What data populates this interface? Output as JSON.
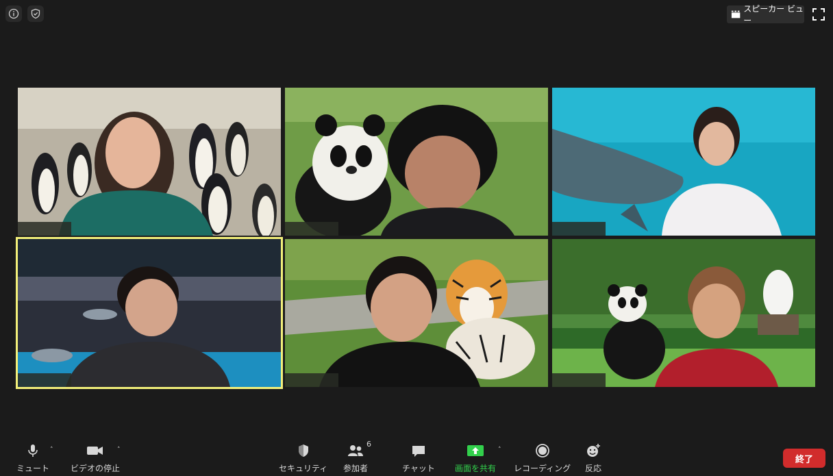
{
  "topbar": {
    "speaker_view_label": "スピーカー ビュー",
    "info_icon": "info-icon",
    "security_icon": "shield-check-icon",
    "fullscreen_icon": "fullscreen-icon"
  },
  "participants": [
    {
      "background": "penguins",
      "name": ""
    },
    {
      "background": "panda",
      "name": ""
    },
    {
      "background": "dolphin-pool",
      "name": ""
    },
    {
      "background": "dolphin-stadium",
      "name": "",
      "active_speaker": true
    },
    {
      "background": "tiger",
      "name": ""
    },
    {
      "background": "panda-garden",
      "name": ""
    }
  ],
  "toolbar": {
    "mute_label": "ミュート",
    "video_label": "ビデオの停止",
    "security_label": "セキュリティ",
    "participants_label": "参加者",
    "participants_count": "6",
    "chat_label": "チャット",
    "share_label": "画面を共有",
    "record_label": "レコーディング",
    "reactions_label": "反応",
    "end_label": "終了"
  },
  "colors": {
    "active_outline": "#f3f07a",
    "share_green": "#32d04c",
    "end_red": "#d12c2c",
    "background": "#1b1b1b"
  }
}
